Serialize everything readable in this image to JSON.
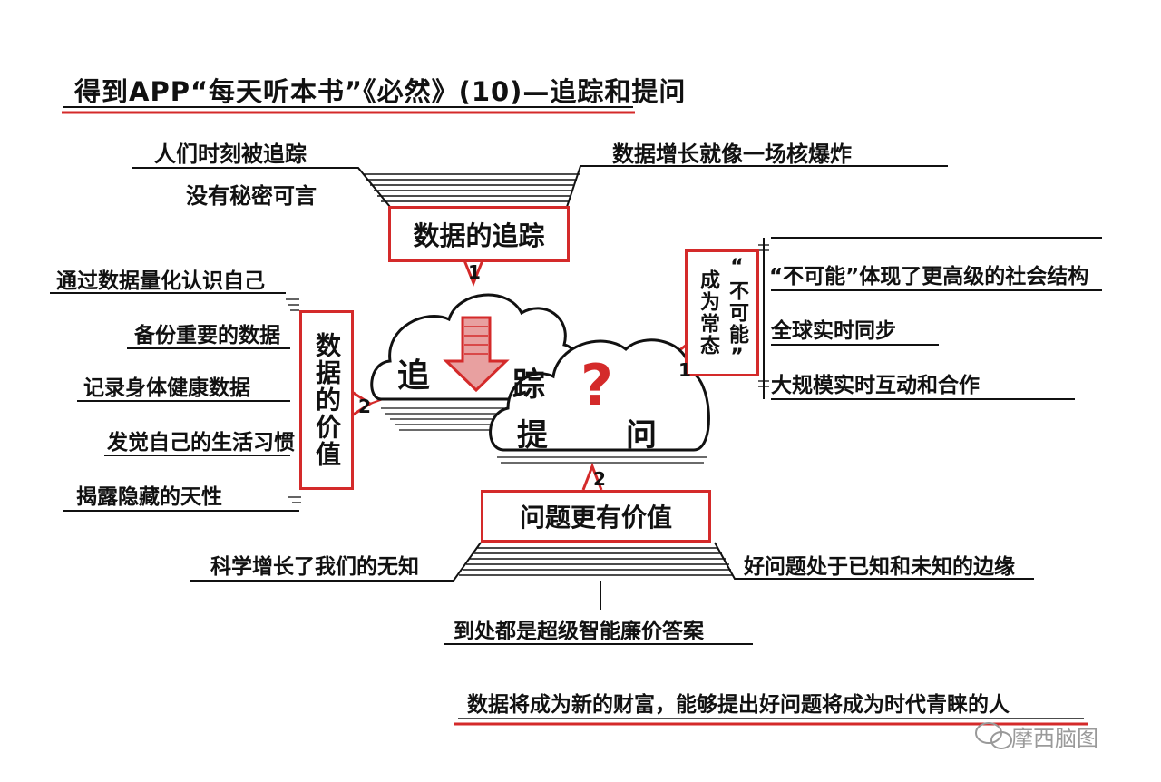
{
  "title": "得到APP“每天听本书”《必然》(10)—追踪和提问",
  "center": {
    "left_cloud": [
      "追",
      "踪"
    ],
    "right_cloud": [
      "提",
      "问"
    ],
    "question_mark": "?"
  },
  "branches": {
    "tracking": {
      "label": "数据的追踪",
      "number": "1",
      "left_text_line1": "人们时刻被追踪",
      "left_text_line2": "没有秘密可言",
      "right_text": "数据增长就像一场核爆炸"
    },
    "value": {
      "label": "数据的价值",
      "number": "2",
      "items": [
        "通过数据量化认识自己",
        "备份重要的数据",
        "记录身体健康数据",
        "发觉自己的生活习惯",
        "揭露隐藏的天性"
      ]
    },
    "impossible": {
      "label_col1": "成为常态",
      "label_col2": "“不可能”",
      "number": "1",
      "items": [
        "“不可能”体现了更高级的社会结构",
        "全球实时同步",
        "大规模实时互动和合作"
      ]
    },
    "questions": {
      "label": "问题更有价值",
      "number": "2",
      "left_text": "科学增长了我们的无知",
      "right_text": "好问题处于已知和未知的边缘",
      "bottom_text": "到处都是超级智能廉价答案"
    }
  },
  "conclusion": "数据将成为新的财富，能够提出好问题将成为时代青睐的人",
  "watermark": "摩西脑图",
  "colors": {
    "accent": "#d42a2a",
    "ink": "#111111"
  }
}
